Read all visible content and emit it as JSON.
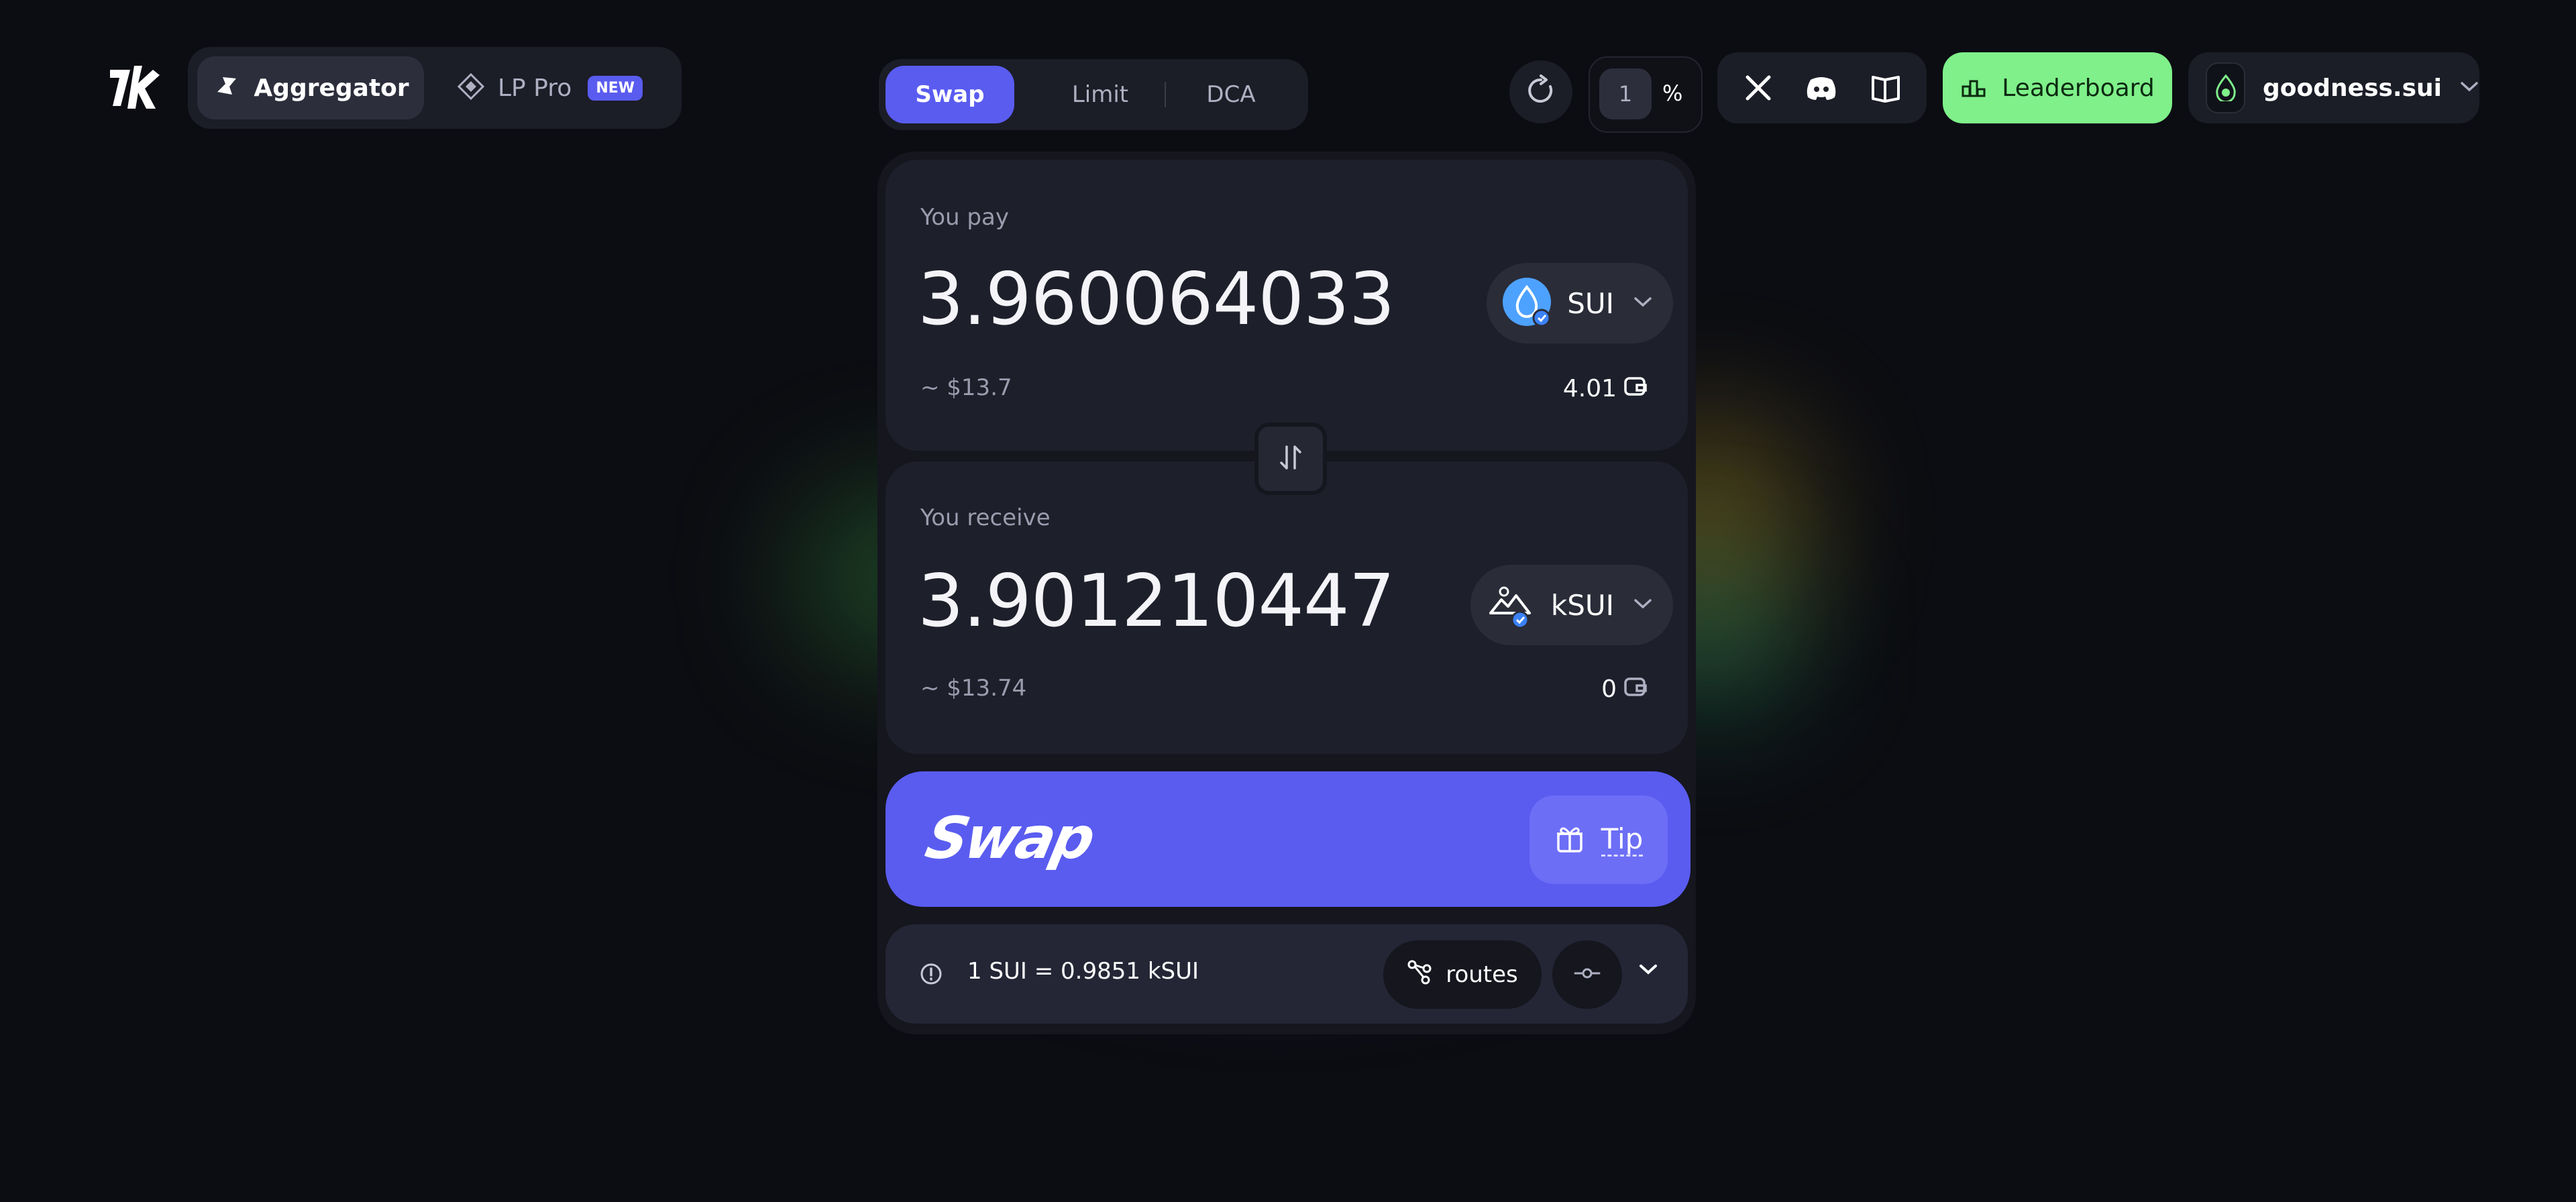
{
  "nav": {
    "aggregator_label": "Aggregator",
    "lppro_label": "LP Pro",
    "lppro_badge": "NEW"
  },
  "tabs": [
    {
      "label": "Swap",
      "active": true
    },
    {
      "label": "Limit",
      "active": false
    },
    {
      "label": "DCA",
      "active": false
    }
  ],
  "slippage": {
    "value": "1",
    "unit": "%"
  },
  "leaderboard_label": "Leaderboard",
  "wallet": {
    "name": "goodness.sui"
  },
  "pay": {
    "label": "You pay",
    "amount": "3.960064033",
    "usd": "~ $13.7",
    "token": "SUI",
    "balance": "4.01"
  },
  "receive": {
    "label": "You receive",
    "amount": "3.901210447",
    "usd": "~ $13.74",
    "token": "kSUI",
    "balance": "0"
  },
  "swap_button": {
    "label": "Swap",
    "tip_label": "Tip"
  },
  "rate": {
    "text": "1 SUI = 0.9851 kSUI",
    "routes_label": "routes"
  },
  "colors": {
    "accent": "#5a5cf0",
    "leaderboard": "#7ff08a",
    "background": "#0c0d12"
  },
  "icons": [
    "logo-icon",
    "aggregator-icon",
    "lppro-icon",
    "refresh-icon",
    "x-icon",
    "discord-icon",
    "docs-icon",
    "leaderboard-icon",
    "wallet-avatar-icon",
    "sui-token-icon",
    "ksui-token-icon",
    "wallet-icon",
    "swap-direction-icon",
    "gift-icon",
    "info-icon",
    "routes-icon",
    "settings-icon",
    "chevron-down-icon"
  ]
}
